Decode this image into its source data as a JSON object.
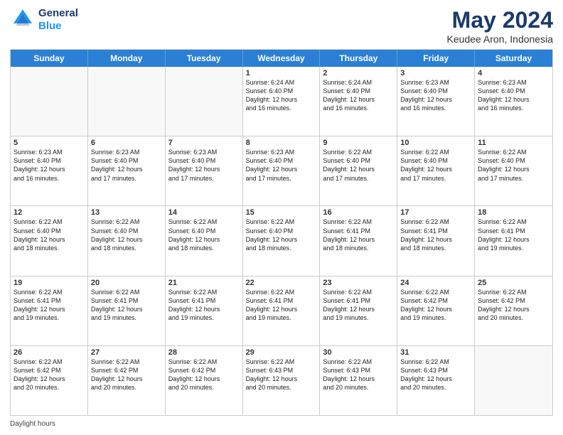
{
  "header": {
    "logo_line1": "General",
    "logo_line2": "Blue",
    "title": "May 2024",
    "subtitle": "Keudee Aron, Indonesia"
  },
  "weekdays": [
    "Sunday",
    "Monday",
    "Tuesday",
    "Wednesday",
    "Thursday",
    "Friday",
    "Saturday"
  ],
  "weeks": [
    [
      {
        "day": "",
        "info": "",
        "empty": true
      },
      {
        "day": "",
        "info": "",
        "empty": true
      },
      {
        "day": "",
        "info": "",
        "empty": true
      },
      {
        "day": "1",
        "info": "Sunrise: 6:24 AM\nSunset: 6:40 PM\nDaylight: 12 hours\nand 16 minutes.",
        "empty": false
      },
      {
        "day": "2",
        "info": "Sunrise: 6:24 AM\nSunset: 6:40 PM\nDaylight: 12 hours\nand 16 minutes.",
        "empty": false
      },
      {
        "day": "3",
        "info": "Sunrise: 6:23 AM\nSunset: 6:40 PM\nDaylight: 12 hours\nand 16 minutes.",
        "empty": false
      },
      {
        "day": "4",
        "info": "Sunrise: 6:23 AM\nSunset: 6:40 PM\nDaylight: 12 hours\nand 16 minutes.",
        "empty": false
      }
    ],
    [
      {
        "day": "5",
        "info": "Sunrise: 6:23 AM\nSunset: 6:40 PM\nDaylight: 12 hours\nand 16 minutes.",
        "empty": false
      },
      {
        "day": "6",
        "info": "Sunrise: 6:23 AM\nSunset: 6:40 PM\nDaylight: 12 hours\nand 17 minutes.",
        "empty": false
      },
      {
        "day": "7",
        "info": "Sunrise: 6:23 AM\nSunset: 6:40 PM\nDaylight: 12 hours\nand 17 minutes.",
        "empty": false
      },
      {
        "day": "8",
        "info": "Sunrise: 6:23 AM\nSunset: 6:40 PM\nDaylight: 12 hours\nand 17 minutes.",
        "empty": false
      },
      {
        "day": "9",
        "info": "Sunrise: 6:22 AM\nSunset: 6:40 PM\nDaylight: 12 hours\nand 17 minutes.",
        "empty": false
      },
      {
        "day": "10",
        "info": "Sunrise: 6:22 AM\nSunset: 6:40 PM\nDaylight: 12 hours\nand 17 minutes.",
        "empty": false
      },
      {
        "day": "11",
        "info": "Sunrise: 6:22 AM\nSunset: 6:40 PM\nDaylight: 12 hours\nand 17 minutes.",
        "empty": false
      }
    ],
    [
      {
        "day": "12",
        "info": "Sunrise: 6:22 AM\nSunset: 6:40 PM\nDaylight: 12 hours\nand 18 minutes.",
        "empty": false
      },
      {
        "day": "13",
        "info": "Sunrise: 6:22 AM\nSunset: 6:40 PM\nDaylight: 12 hours\nand 18 minutes.",
        "empty": false
      },
      {
        "day": "14",
        "info": "Sunrise: 6:22 AM\nSunset: 6:40 PM\nDaylight: 12 hours\nand 18 minutes.",
        "empty": false
      },
      {
        "day": "15",
        "info": "Sunrise: 6:22 AM\nSunset: 6:40 PM\nDaylight: 12 hours\nand 18 minutes.",
        "empty": false
      },
      {
        "day": "16",
        "info": "Sunrise: 6:22 AM\nSunset: 6:41 PM\nDaylight: 12 hours\nand 18 minutes.",
        "empty": false
      },
      {
        "day": "17",
        "info": "Sunrise: 6:22 AM\nSunset: 6:41 PM\nDaylight: 12 hours\nand 18 minutes.",
        "empty": false
      },
      {
        "day": "18",
        "info": "Sunrise: 6:22 AM\nSunset: 6:41 PM\nDaylight: 12 hours\nand 19 minutes.",
        "empty": false
      }
    ],
    [
      {
        "day": "19",
        "info": "Sunrise: 6:22 AM\nSunset: 6:41 PM\nDaylight: 12 hours\nand 19 minutes.",
        "empty": false
      },
      {
        "day": "20",
        "info": "Sunrise: 6:22 AM\nSunset: 6:41 PM\nDaylight: 12 hours\nand 19 minutes.",
        "empty": false
      },
      {
        "day": "21",
        "info": "Sunrise: 6:22 AM\nSunset: 6:41 PM\nDaylight: 12 hours\nand 19 minutes.",
        "empty": false
      },
      {
        "day": "22",
        "info": "Sunrise: 6:22 AM\nSunset: 6:41 PM\nDaylight: 12 hours\nand 19 minutes.",
        "empty": false
      },
      {
        "day": "23",
        "info": "Sunrise: 6:22 AM\nSunset: 6:41 PM\nDaylight: 12 hours\nand 19 minutes.",
        "empty": false
      },
      {
        "day": "24",
        "info": "Sunrise: 6:22 AM\nSunset: 6:42 PM\nDaylight: 12 hours\nand 19 minutes.",
        "empty": false
      },
      {
        "day": "25",
        "info": "Sunrise: 6:22 AM\nSunset: 6:42 PM\nDaylight: 12 hours\nand 20 minutes.",
        "empty": false
      }
    ],
    [
      {
        "day": "26",
        "info": "Sunrise: 6:22 AM\nSunset: 6:42 PM\nDaylight: 12 hours\nand 20 minutes.",
        "empty": false
      },
      {
        "day": "27",
        "info": "Sunrise: 6:22 AM\nSunset: 6:42 PM\nDaylight: 12 hours\nand 20 minutes.",
        "empty": false
      },
      {
        "day": "28",
        "info": "Sunrise: 6:22 AM\nSunset: 6:42 PM\nDaylight: 12 hours\nand 20 minutes.",
        "empty": false
      },
      {
        "day": "29",
        "info": "Sunrise: 6:22 AM\nSunset: 6:43 PM\nDaylight: 12 hours\nand 20 minutes.",
        "empty": false
      },
      {
        "day": "30",
        "info": "Sunrise: 6:22 AM\nSunset: 6:43 PM\nDaylight: 12 hours\nand 20 minutes.",
        "empty": false
      },
      {
        "day": "31",
        "info": "Sunrise: 6:22 AM\nSunset: 6:43 PM\nDaylight: 12 hours\nand 20 minutes.",
        "empty": false
      },
      {
        "day": "",
        "info": "",
        "empty": true
      }
    ]
  ],
  "footer": {
    "daylight_hours": "Daylight hours"
  }
}
